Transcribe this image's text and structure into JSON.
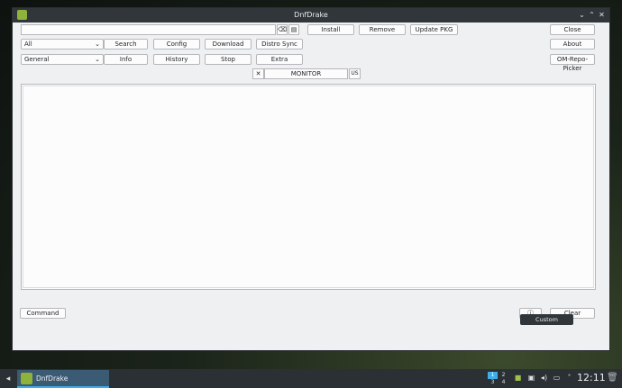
{
  "window": {
    "title": "DnfDrake"
  },
  "toolbar": {
    "install": "Install",
    "remove": "Remove",
    "update_pkg": "Update PKG",
    "close": "Close",
    "search": "Search",
    "config": "Config",
    "download": "Download",
    "distro_sync": "Distro Sync",
    "about": "About",
    "info": "Info",
    "history": "History",
    "stop": "Stop",
    "extra": "Extra",
    "om_repo_picker": "OM-Repo-Picker"
  },
  "filters": {
    "scope_selected": "All",
    "category_selected": "General"
  },
  "status": {
    "monitor": "MONITOR",
    "lang": "US"
  },
  "bottom": {
    "command": "Command",
    "clear": "Clear",
    "tooltip": "Custom command"
  },
  "taskbar": {
    "task_label": "DnfDrake",
    "pager": [
      "1",
      "2",
      "3",
      "4"
    ],
    "clock": "12:11"
  }
}
